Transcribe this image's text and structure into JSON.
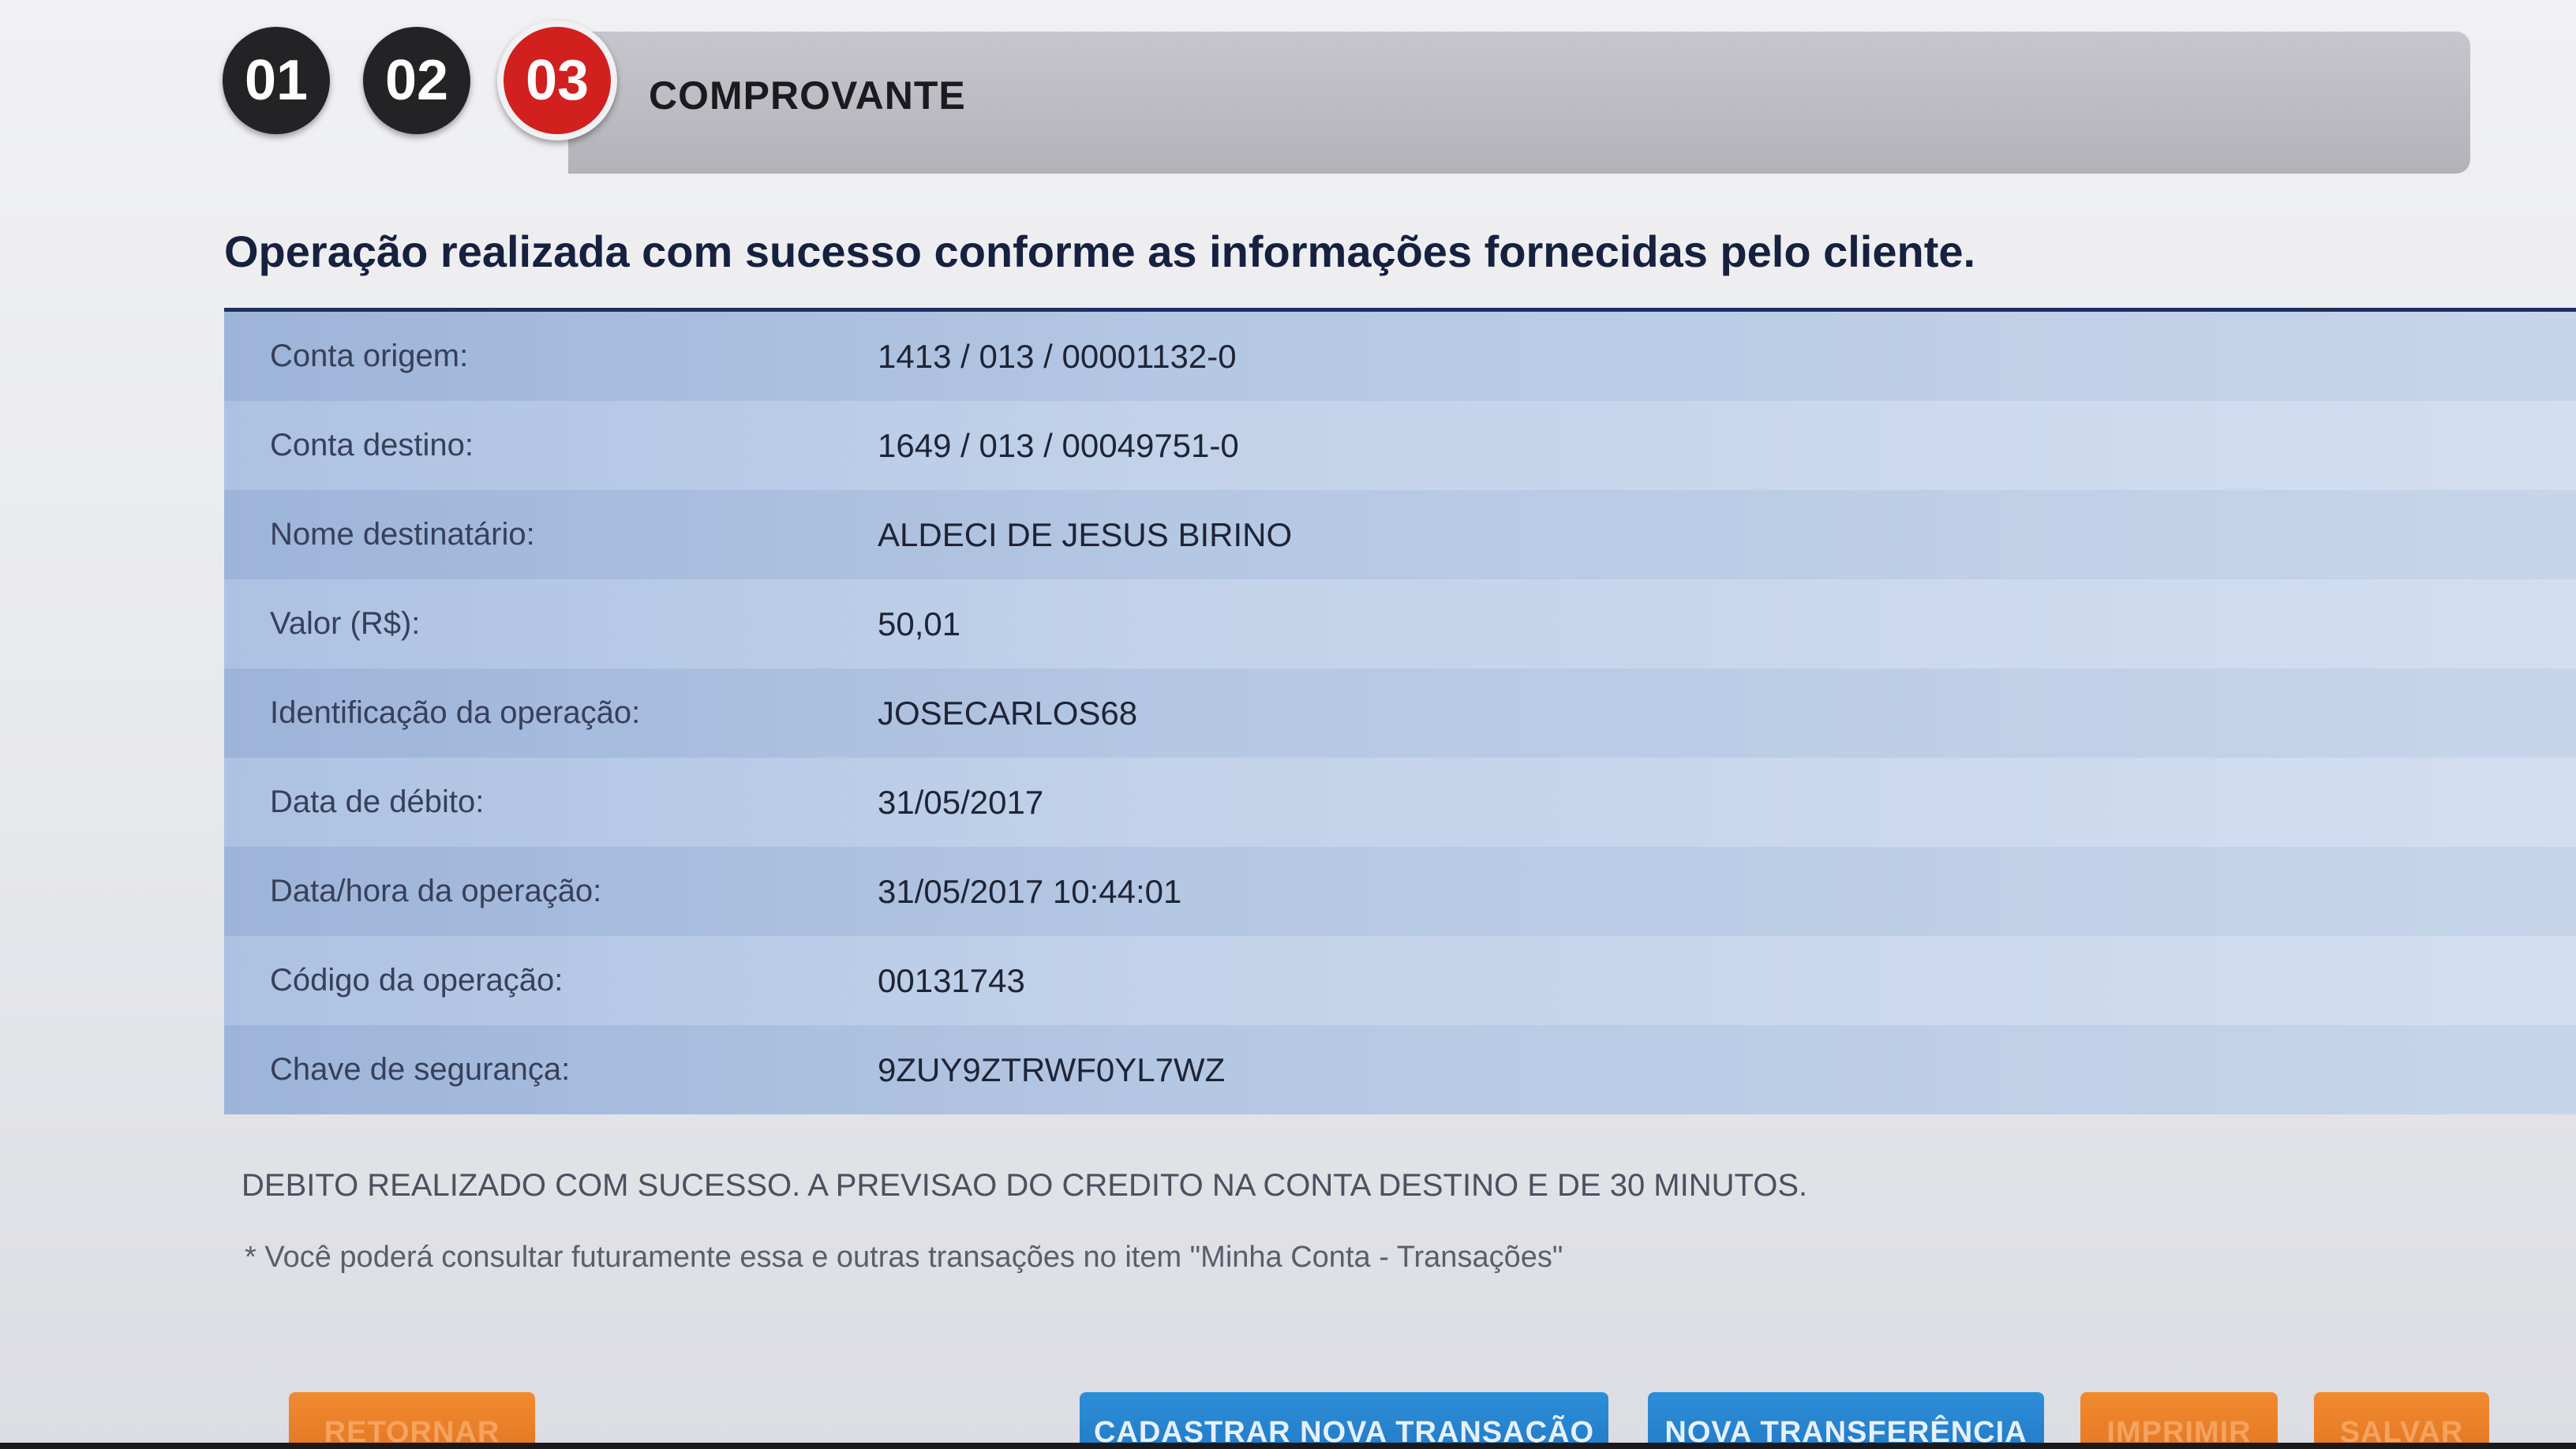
{
  "stepper": {
    "steps": [
      "01",
      "02",
      "03"
    ],
    "active_step": "03",
    "current_title": "COMPROVANTE"
  },
  "heading": "Operação realizada com sucesso conforme as informações fornecidas pelo cliente.",
  "details": [
    {
      "label": "Conta origem:",
      "value": "1413 / 013 / 00001132-0"
    },
    {
      "label": "Conta destino:",
      "value": "1649 / 013 / 00049751-0"
    },
    {
      "label": "Nome destinatário:",
      "value": "ALDECI DE JESUS BIRINO"
    },
    {
      "label": "Valor (R$):",
      "value": "50,01"
    },
    {
      "label": "Identificação da operação:",
      "value": "JOSECARLOS68"
    },
    {
      "label": "Data de débito:",
      "value": "31/05/2017"
    },
    {
      "label": "Data/hora da operação:",
      "value": "31/05/2017 10:44:01"
    },
    {
      "label": "Código da operação:",
      "value": "00131743"
    },
    {
      "label": "Chave de segurança:",
      "value": "9ZUY9ZTRWF0YL7WZ"
    }
  ],
  "notice": "DEBITO REALIZADO COM SUCESSO. A PREVISAO DO CREDITO NA CONTA DESTINO E DE 30 MINUTOS.",
  "footnote": "* Você poderá consultar futuramente essa e outras transações no item \"Minha Conta - Transações\"",
  "buttons": {
    "retornar": "RETORNAR",
    "cadastrar": "CADASTRAR NOVA TRANSAÇÃO",
    "nova_transferencia": "NOVA TRANSFERÊNCIA",
    "imprimir": "IMPRIMIR",
    "salvar": "SALVAR"
  },
  "colors": {
    "active_step": "#d1201e",
    "inactive_step": "#232326",
    "table_blue": "#b4c7e3",
    "heading_rule": "#1d2f63",
    "button_orange": "#e0701d",
    "button_blue": "#1f73bf"
  }
}
